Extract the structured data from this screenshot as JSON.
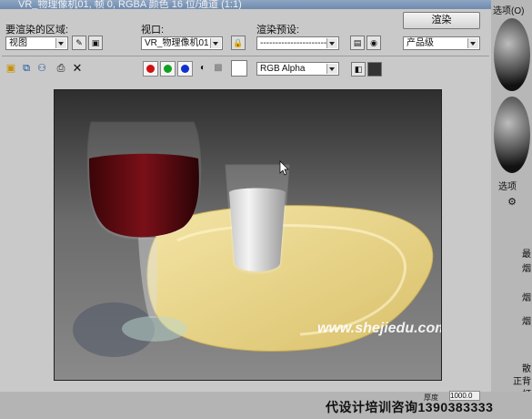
{
  "window": {
    "title": "VR_物理像机01, 帧 0, RGBA 颜色 16 位/通道 (1:1)"
  },
  "area": {
    "label": "要渲染的区域:",
    "value": "视图"
  },
  "viewport": {
    "label": "视口:",
    "value": "VR_物理像机01"
  },
  "preset": {
    "label": "渲染预设:",
    "value": "-------------------------"
  },
  "render_button": "渲染",
  "quality": {
    "value": "产品级"
  },
  "channel": {
    "value": "RGB Alpha"
  },
  "watermark": "www.shejiedu.com",
  "right_panel": {
    "top_text": "选项(O)",
    "tab_text": "选项",
    "labels": [
      "最",
      "烟",
      "烟",
      "烟",
      "散",
      "正背",
      "灯"
    ]
  },
  "bottom": {
    "thickness_label": "厚度",
    "thickness_value": "1000.0",
    "promo": "代设计培训咨询1390383333"
  },
  "colors": {
    "red": "#d01010",
    "green": "#10a020",
    "blue": "#1030d0",
    "accent": "#6f8aad"
  },
  "icons": [
    "save-icon",
    "copy-icon",
    "clone-icon",
    "print-icon",
    "clear-icon",
    "lock-icon",
    "preset-load-icon",
    "preset-save-icon",
    "mono-icon",
    "alpha-icon",
    "toggle-ui-icon",
    "overlay-icon"
  ]
}
